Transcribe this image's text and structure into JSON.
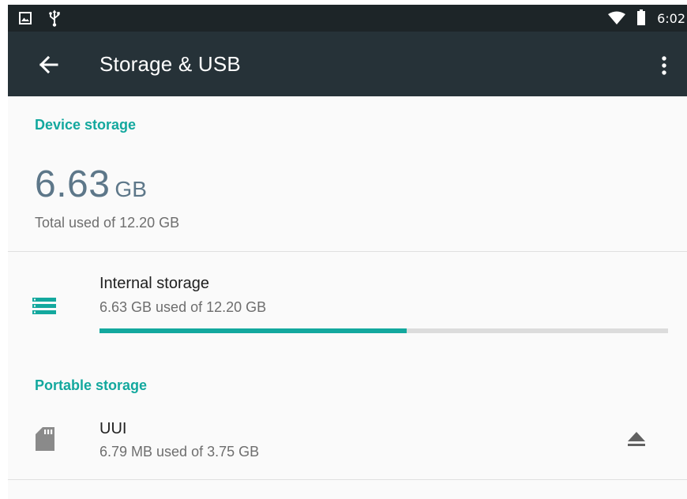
{
  "status_bar": {
    "time": "6:02",
    "icons": [
      "image-icon",
      "usb-icon",
      "wifi-icon",
      "battery-icon"
    ]
  },
  "app_bar": {
    "title": "Storage & USB",
    "back_icon": "arrow-back-icon",
    "overflow_icon": "more-vert-icon"
  },
  "device_storage": {
    "header": "Device storage",
    "used_value": "6.63",
    "used_unit": "GB",
    "total_label": "Total used of 12.20 GB",
    "internal": {
      "icon": "storage-icon",
      "title": "Internal storage",
      "subtitle": "6.63 GB used of 12.20 GB",
      "used_fraction": 0.54
    }
  },
  "portable_storage": {
    "header": "Portable storage",
    "items": [
      {
        "icon": "sd-card-icon",
        "title": "UUI",
        "subtitle": "6.79 MB used of 3.75 GB",
        "action_icon": "eject-icon"
      }
    ]
  },
  "colors": {
    "accent": "#13a89e",
    "app_bar": "#263238",
    "status_bar": "#1d2528",
    "big_value": "#5d7789"
  }
}
